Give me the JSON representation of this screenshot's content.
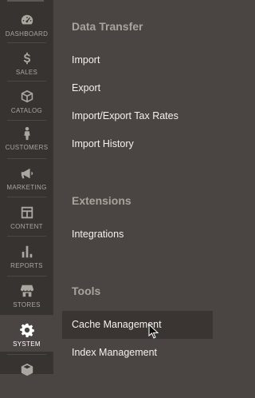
{
  "sidebar": {
    "items": [
      {
        "label": "DASHBOARD",
        "icon": "dashboard-icon"
      },
      {
        "label": "SALES",
        "icon": "dollar-icon"
      },
      {
        "label": "CATALOG",
        "icon": "box-icon"
      },
      {
        "label": "CUSTOMERS",
        "icon": "person-icon"
      },
      {
        "label": "MARKETING",
        "icon": "megaphone-icon"
      },
      {
        "label": "CONTENT",
        "icon": "layout-icon"
      },
      {
        "label": "REPORTS",
        "icon": "bar-chart-icon"
      },
      {
        "label": "STORES",
        "icon": "storefront-icon"
      },
      {
        "label": "SYSTEM",
        "icon": "gear-icon"
      },
      {
        "label": "",
        "icon": "cube-icon"
      }
    ],
    "active": "SYSTEM"
  },
  "panel": {
    "data_transfer": {
      "title": "Data Transfer",
      "links": [
        "Import",
        "Export",
        "Import/Export Tax Rates",
        "Import History"
      ]
    },
    "extensions": {
      "title": "Extensions",
      "links": [
        "Integrations"
      ]
    },
    "tools": {
      "title": "Tools",
      "links": [
        "Cache Management",
        "Index Management"
      ]
    }
  },
  "colors": {
    "sidebar_bg": "#373330",
    "panel_bg": "#4a4542",
    "section_title": "#a9a39c",
    "link_text": "#f4f1ec",
    "hover_bg": "#3a3532"
  }
}
